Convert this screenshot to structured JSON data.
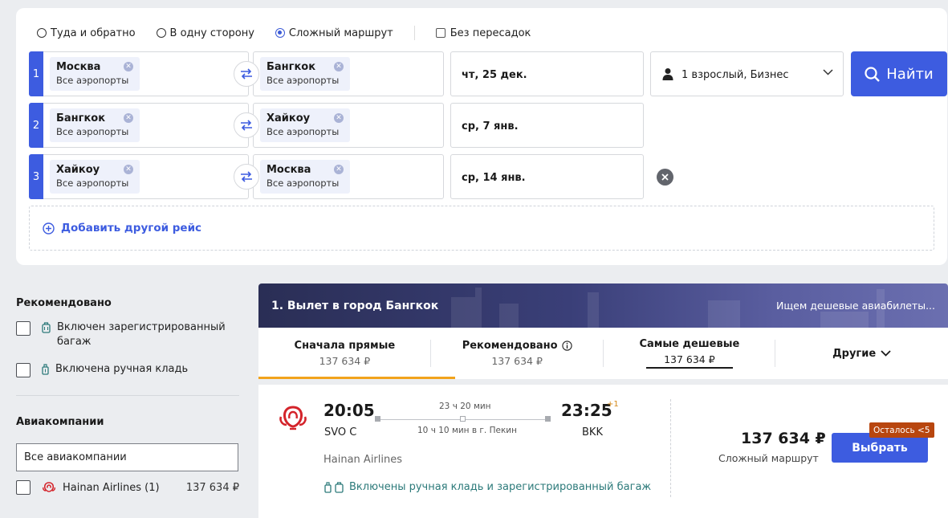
{
  "trip_types": {
    "options": [
      "Туда и обратно",
      "В одну сторону",
      "Сложный маршрут"
    ],
    "selected_index": 2,
    "direct_only_label": "Без пересадок"
  },
  "legs": [
    {
      "num": "1",
      "from_city": "Москва",
      "from_sub": "Все аэропорты",
      "to_city": "Бангкок",
      "to_sub": "Все аэропорты",
      "date": "чт, 25 дек."
    },
    {
      "num": "2",
      "from_city": "Бангкок",
      "from_sub": "Все аэропорты",
      "to_city": "Хайкоу",
      "to_sub": "Все аэропорты",
      "date": "ср, 7 янв."
    },
    {
      "num": "3",
      "from_city": "Хайкоу",
      "from_sub": "Все аэропорты",
      "to_city": "Москва",
      "to_sub": "Все аэропорты",
      "date": "ср, 14 янв."
    }
  ],
  "passengers": "1 взрослый, Бизнес",
  "find_button": "Найти",
  "add_leg": "Добавить другой рейс",
  "filters": {
    "recommended_title": "Рекомендовано",
    "checked_baggage": "Включен зарегистрированный багаж",
    "hand_luggage": "Включена ручная кладь",
    "airlines_title": "Авиакомпании",
    "airlines_select": "Все авиакомпании",
    "airline_name": "Hainan Airlines (1)",
    "airline_price": "137 634 ₽"
  },
  "results": {
    "header_title": "1. Вылет в город Бангкок",
    "header_status": "Ищем дешевые авиабилеты...",
    "sort_tabs": [
      {
        "label": "Сначала прямые",
        "price": "137 634 ₽"
      },
      {
        "label": "Рекомендовано",
        "price": "137 634 ₽"
      },
      {
        "label": "Самые дешевые",
        "price": "137 634 ₽"
      },
      {
        "label": "Другие",
        "price": ""
      }
    ],
    "ticket": {
      "dep_time": "20:05",
      "dep_code": "SVO C",
      "arr_time": "23:25",
      "arr_plus": "+1",
      "arr_code": "BKK",
      "duration": "23 ч 20 мин",
      "layover": "10 ч 10 мин в г. Пекин",
      "airline": "Hainan Airlines",
      "baggage": "Включены ручная кладь и зарегистрированный багаж",
      "price": "137 634 ₽",
      "price_sub": "Сложный маршрут",
      "select_label": "Выбрать",
      "seats_left": "Осталось <5"
    }
  },
  "colors": {
    "accent": "#3d5ce0",
    "active_underline": "#f2a31c",
    "badge": "#b8460f",
    "baggage_text": "#2c7a7a"
  }
}
